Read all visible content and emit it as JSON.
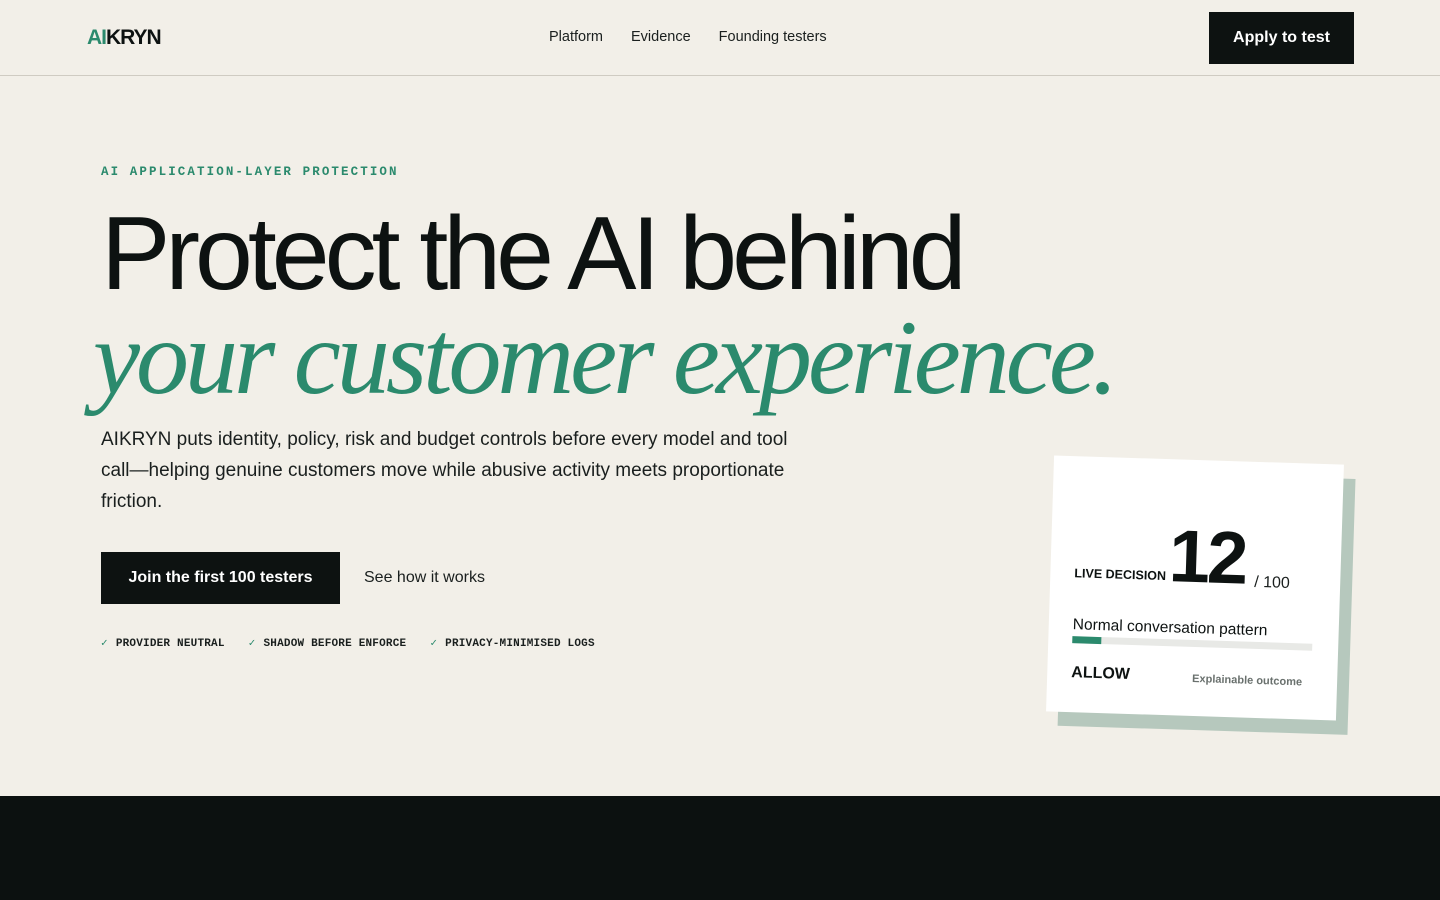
{
  "header": {
    "logo": {
      "accent": "AI",
      "rest": "KRYN"
    },
    "nav": [
      {
        "label": "Platform"
      },
      {
        "label": "Evidence"
      },
      {
        "label": "Founding testers"
      }
    ],
    "cta": "Apply to test"
  },
  "hero": {
    "eyebrow": "AI APPLICATION-LAYER PROTECTION",
    "headline_line1": "Protect the AI behind",
    "headline_line2": "your customer experience.",
    "lede": "AIKRYN puts identity, policy, risk and budget controls before every model and tool call—helping genuine customers move while abusive activity meets proportionate friction.",
    "primary_cta": "Join the first 100 testers",
    "secondary_cta": "See how it works",
    "badges": [
      {
        "check": "✓",
        "label": "PROVIDER NEUTRAL"
      },
      {
        "check": "✓",
        "label": "SHADOW BEFORE ENFORCE"
      },
      {
        "check": "✓",
        "label": "PRIVACY-MINIMISED LOGS"
      }
    ]
  },
  "decision_card": {
    "label": "LIVE DECISION",
    "score": "12",
    "score_max": "/ 100",
    "pattern": "Normal conversation pattern",
    "risk_fraction": 0.12,
    "outcome": "ALLOW",
    "outcome_note": "Explainable outcome"
  },
  "colors": {
    "accent": "#2b8a6d",
    "ink": "#0d1211",
    "background": "#f2efe8",
    "card_shadow": "#b6c8bd"
  }
}
